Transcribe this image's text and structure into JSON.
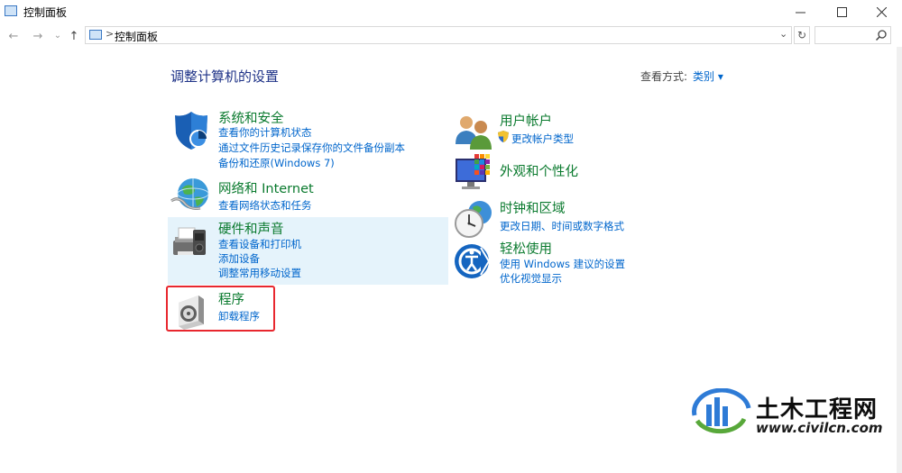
{
  "window": {
    "title": "控制面板"
  },
  "nav": {
    "back_glyph": "←",
    "forward_glyph": "→",
    "recent_glyph": "⌄",
    "up_glyph": "↑",
    "address_separator": ">",
    "address_text": "控制面板",
    "address_dropdown_glyph": "⌄",
    "refresh_glyph": "↻",
    "search_placeholder": ""
  },
  "main": {
    "heading": "调整计算机的设置",
    "view_by_label": "查看方式:",
    "view_by_value": "类别 ▾"
  },
  "categories_left": [
    {
      "title": "系统和安全",
      "links": [
        "查看你的计算机状态",
        "通过文件历史记录保存你的文件备份副本",
        "备份和还原(Windows 7)"
      ]
    },
    {
      "title": "网络和 Internet",
      "links": [
        "查看网络状态和任务"
      ]
    },
    {
      "title": "硬件和声音",
      "links": [
        "查看设备和打印机",
        "添加设备",
        "调整常用移动设置"
      ]
    },
    {
      "title": "程序",
      "links": [
        "卸载程序"
      ]
    }
  ],
  "categories_right": [
    {
      "title": "用户帐户",
      "links": [
        "更改帐户类型"
      ]
    },
    {
      "title": "外观和个性化",
      "links": []
    },
    {
      "title": "时钟和区域",
      "links": [
        "更改日期、时间或数字格式"
      ]
    },
    {
      "title": "轻松使用",
      "links": [
        "使用 Windows 建议的设置",
        "优化视觉显示"
      ]
    }
  ],
  "watermark": {
    "brand": "土木工程网",
    "url": "www.civilcn.com"
  },
  "colors": {
    "category_green": "#0a7a2e",
    "link_blue": "#0066cc",
    "heading_blue": "#1e3287",
    "highlight_red": "#e8272e",
    "hover_bg": "#e5f3fb"
  }
}
